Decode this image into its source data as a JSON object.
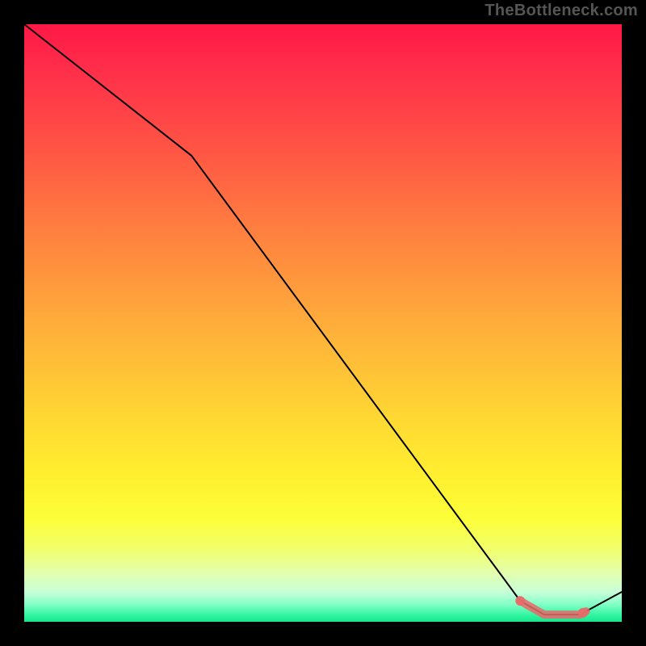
{
  "watermark": "TheBottleneck.com",
  "chart_data": {
    "type": "line",
    "title": "",
    "xlabel": "",
    "ylabel": "",
    "xlim": [
      0,
      100
    ],
    "ylim": [
      0,
      100
    ],
    "grid": false,
    "series": [
      {
        "name": "bottleneck-curve",
        "x": [
          0,
          28,
          83,
          87,
          93,
          100
        ],
        "values": [
          100,
          78,
          3.5,
          1.2,
          1.2,
          5
        ]
      }
    ],
    "highlight": {
      "name": "optimal-range",
      "x_range": [
        83,
        94
      ],
      "y_approx": 2,
      "color": "#e86a6a"
    },
    "markers": [
      {
        "x": 83,
        "y": 3.5
      },
      {
        "x": 93.5,
        "y": 1.5
      }
    ],
    "colors": {
      "gradient_top": "#ff1846",
      "gradient_mid": "#fff02f",
      "gradient_bottom": "#18e48d",
      "line": "#000000",
      "highlight": "#e86a6a",
      "frame": "#000000"
    }
  }
}
